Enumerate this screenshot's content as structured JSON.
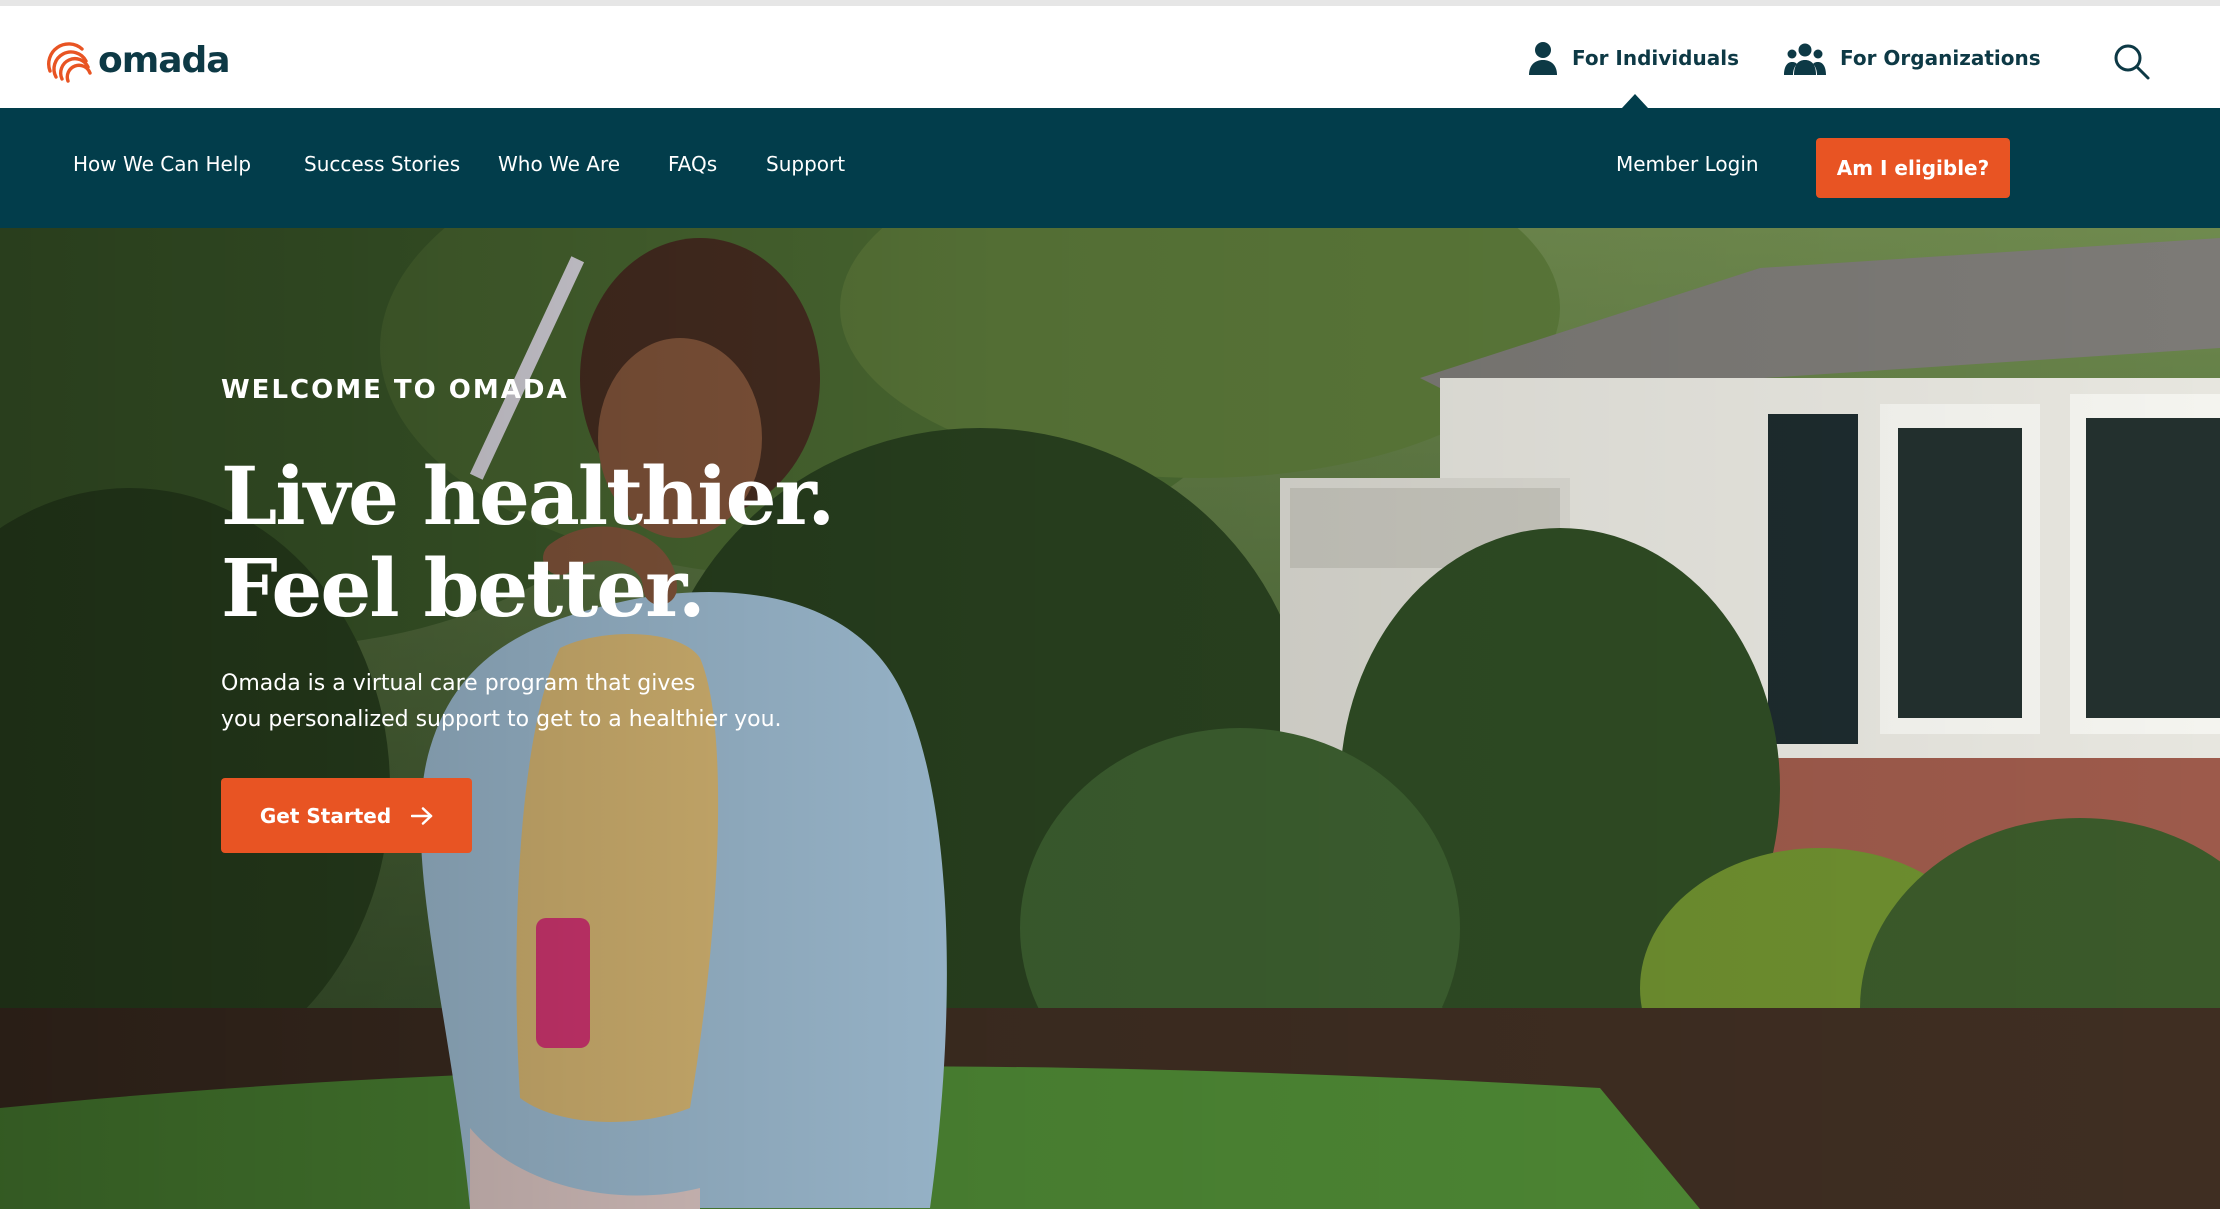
{
  "brand": {
    "name": "omada",
    "accent": "#e85423",
    "navy": "#023d4b",
    "text_dark": "#0d3945"
  },
  "audience": {
    "individuals_label": "For Individuals",
    "organizations_label": "For Organizations",
    "active": "individuals"
  },
  "nav": {
    "items": [
      {
        "label": "How We Can Help"
      },
      {
        "label": "Success Stories"
      },
      {
        "label": "Who We Are"
      },
      {
        "label": "FAQs"
      },
      {
        "label": "Support"
      }
    ],
    "member_login": "Member Login",
    "eligible_button": "Am I eligible?"
  },
  "hero": {
    "eyebrow": "WELCOME TO OMADA",
    "headline_line1": "Live healthier.",
    "headline_line2": "Feel better.",
    "subtext_line1": "Omada is a virtual care program that gives",
    "subtext_line2": "you personalized support to get to a healthier you.",
    "cta_label": "Get Started"
  },
  "icons": {
    "logo": "omada-logo-icon",
    "individual": "person-icon",
    "organization": "group-icon",
    "search": "search-icon",
    "arrow": "arrow-right-icon"
  }
}
